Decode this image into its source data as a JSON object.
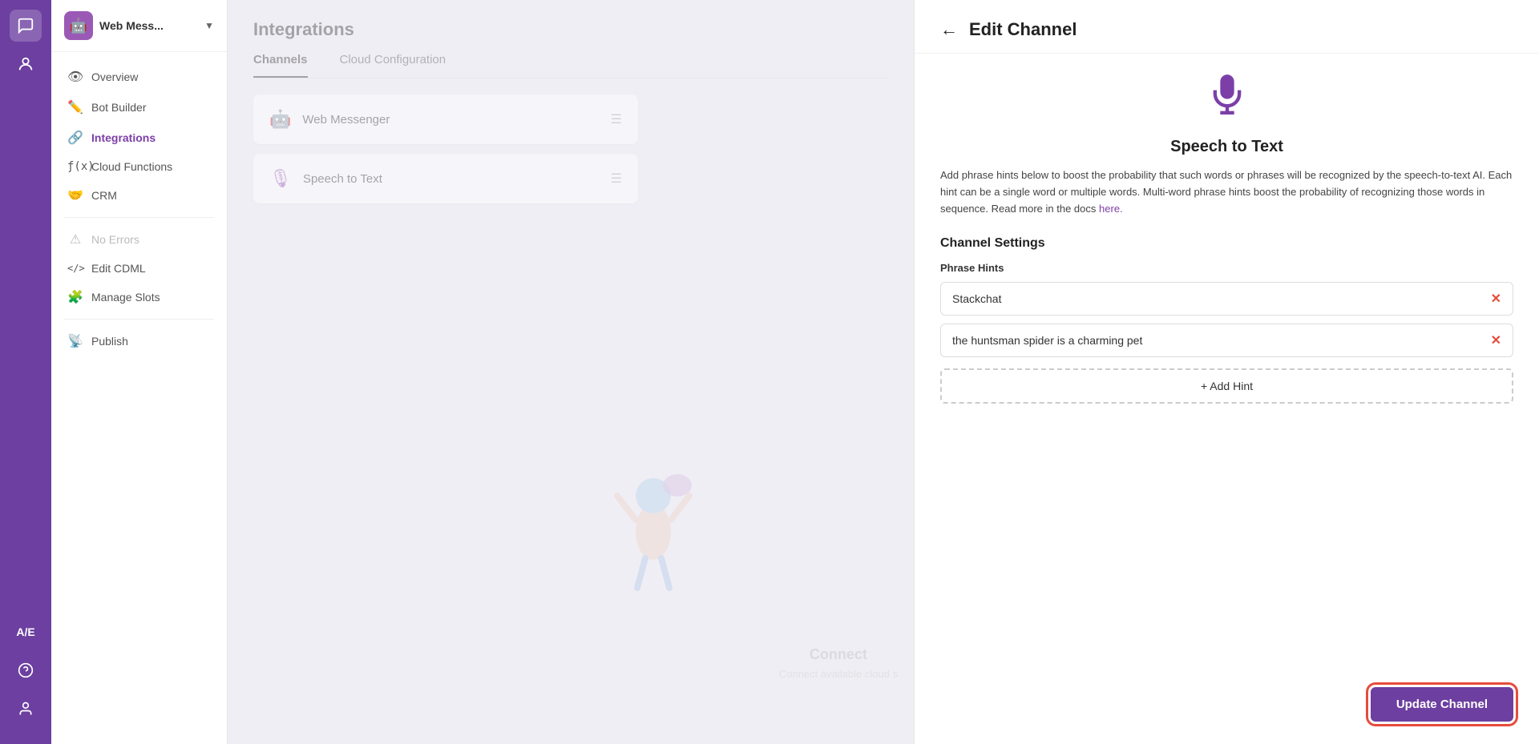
{
  "iconBar": {
    "icons": [
      "chat-icon",
      "bot-icon",
      "language-icon",
      "help-icon",
      "user-icon"
    ]
  },
  "sidebar": {
    "botName": "Web Mess...",
    "navItems": [
      {
        "id": "overview",
        "label": "Overview",
        "icon": "👁"
      },
      {
        "id": "bot-builder",
        "label": "Bot Builder",
        "icon": "✏️"
      },
      {
        "id": "integrations",
        "label": "Integrations",
        "icon": "🔗",
        "active": true
      },
      {
        "id": "cloud-functions",
        "label": "Cloud Functions",
        "icon": "ƒ"
      },
      {
        "id": "crm",
        "label": "CRM",
        "icon": "🤝"
      },
      {
        "id": "no-errors",
        "label": "No Errors",
        "icon": "⚠"
      },
      {
        "id": "edit-cdml",
        "label": "Edit CDML",
        "icon": "</>"
      },
      {
        "id": "manage-slots",
        "label": "Manage Slots",
        "icon": "🧩"
      },
      {
        "id": "publish",
        "label": "Publish",
        "icon": "📡"
      }
    ]
  },
  "main": {
    "title": "Integrations",
    "tabs": [
      {
        "id": "channels",
        "label": "Channels",
        "active": true
      },
      {
        "id": "cloud-config",
        "label": "Cloud Configuration"
      }
    ],
    "channels": [
      {
        "id": "web-messenger",
        "name": "Web Messenger",
        "icon": "🤖"
      },
      {
        "id": "speech-to-text",
        "name": "Speech to Text",
        "icon": "🎙"
      }
    ],
    "connectTitle": "Connect",
    "connectSubtitle": "Connect available cloud s"
  },
  "editPanel": {
    "backLabel": "←",
    "title": "Edit Channel",
    "channelTitle": "Speech to Text",
    "description": "Add phrase hints below to boost the probability that such words or phrases will be recognized by the speech-to-text AI. Each hint can be a single word or multiple words. Multi-word phrase hints boost the probability of recognizing those words in sequence. Read more in the docs",
    "docsLinkText": "here.",
    "settingsHeading": "Channel Settings",
    "phraseHintsLabel": "Phrase Hints",
    "hints": [
      {
        "id": "hint-1",
        "value": "Stackchat"
      },
      {
        "id": "hint-2",
        "value": "the huntsman spider is a charming pet"
      }
    ],
    "addHintLabel": "+ Add Hint",
    "updateButtonLabel": "Update Channel"
  }
}
